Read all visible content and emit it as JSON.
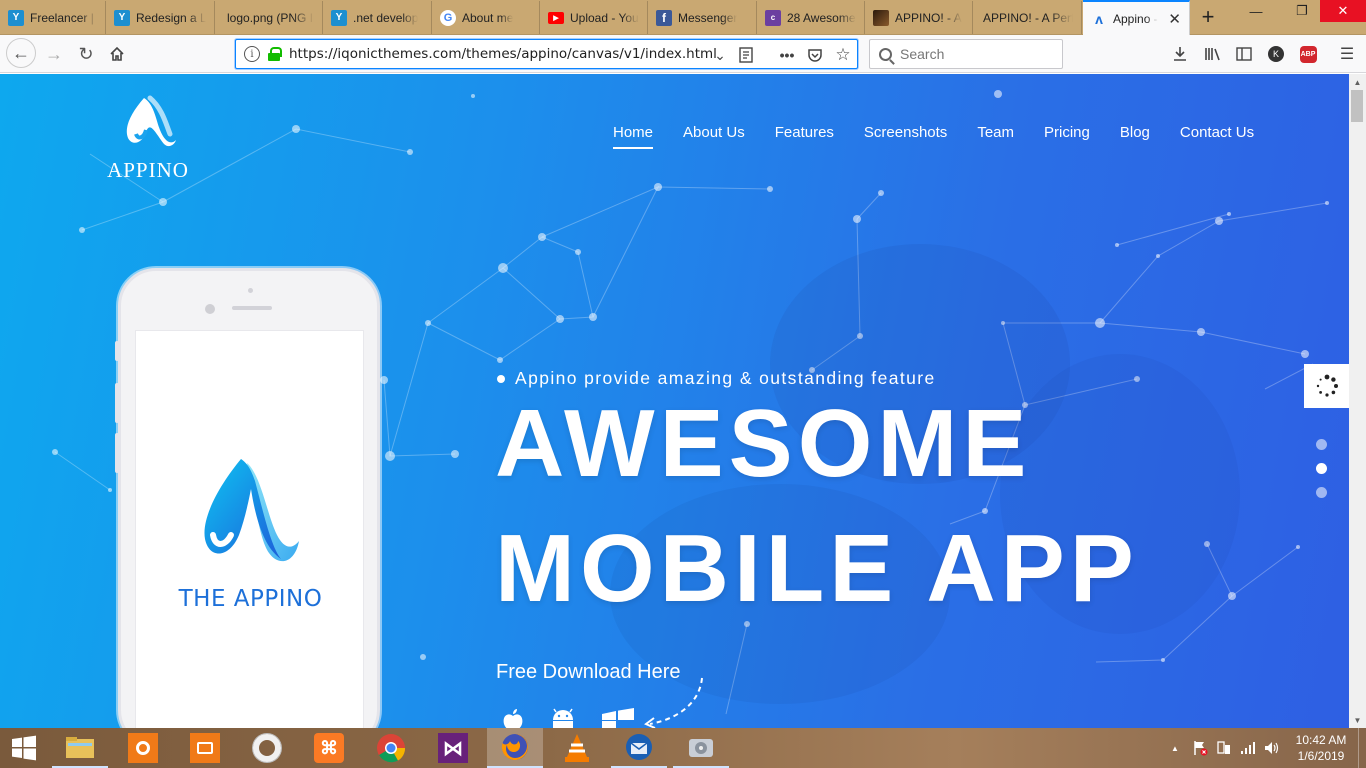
{
  "browser": {
    "tabs": [
      {
        "label": "Freelancer | C",
        "icon": "freelancer-icon",
        "color": "#1d8fd0",
        "glyph": "Y"
      },
      {
        "label": "Redesign a L",
        "icon": "freelancer-icon",
        "color": "#1d8fd0",
        "glyph": "Y"
      },
      {
        "label": "logo.png (PNG Ir",
        "icon": "",
        "color": "",
        "glyph": ""
      },
      {
        "label": ".net develop",
        "icon": "freelancer-icon",
        "color": "#1d8fd0",
        "glyph": "Y"
      },
      {
        "label": "About me",
        "icon": "google-icon",
        "color": "#ffffff",
        "glyph": "G"
      },
      {
        "label": "Upload - You",
        "icon": "youtube-icon",
        "color": "#ff0000",
        "glyph": "▶"
      },
      {
        "label": "Messenger",
        "icon": "facebook-icon",
        "color": "#3b5998",
        "glyph": "f"
      },
      {
        "label": "28 Awesome",
        "icon": "colorlib-icon",
        "color": "#6b3fa0",
        "glyph": "c"
      },
      {
        "label": "APPINO! - A",
        "icon": "themeforest-icon",
        "color": "#5c3b1e",
        "glyph": ""
      },
      {
        "label": "APPINO! - A Perf",
        "icon": "",
        "color": "",
        "glyph": ""
      },
      {
        "label": "Appino -",
        "icon": "appino-icon",
        "color": "#1d70d9",
        "glyph": "ʌ"
      }
    ],
    "url": "https://iqonicthemes.com/themes/appino/canvas/v1/index.html",
    "search_placeholder": "Search"
  },
  "page": {
    "logo_text": "APPINO",
    "nav": [
      "Home",
      "About Us",
      "Features",
      "Screenshots",
      "Team",
      "Pricing",
      "Blog",
      "Contact Us"
    ],
    "active_nav": "Home",
    "phone_app_name": "THE APPINO",
    "tagline": "Appino provide amazing & outstanding feature",
    "hero_line1": "AWESOME",
    "hero_line2": "MOBILE APP",
    "download_label": "Free Download Here",
    "stores": [
      "apple-icon",
      "android-icon",
      "windows-icon"
    ],
    "pagination_active": 1,
    "colors": {
      "bg_start": "#0ea8ee",
      "bg_end": "#2e5fe3",
      "accent": "#1d70d9"
    }
  },
  "taskbar": {
    "time": "10:42 AM",
    "date": "1/6/2019",
    "apps": [
      "windows-start-icon",
      "file-explorer-icon",
      "camtasia-recorder-icon",
      "camera-app-icon",
      "opera-icon",
      "xampp-icon",
      "chrome-icon",
      "visual-studio-icon",
      "firefox-icon",
      "vlc-icon",
      "thunderbird-icon",
      "hdd-tool-icon"
    ]
  }
}
